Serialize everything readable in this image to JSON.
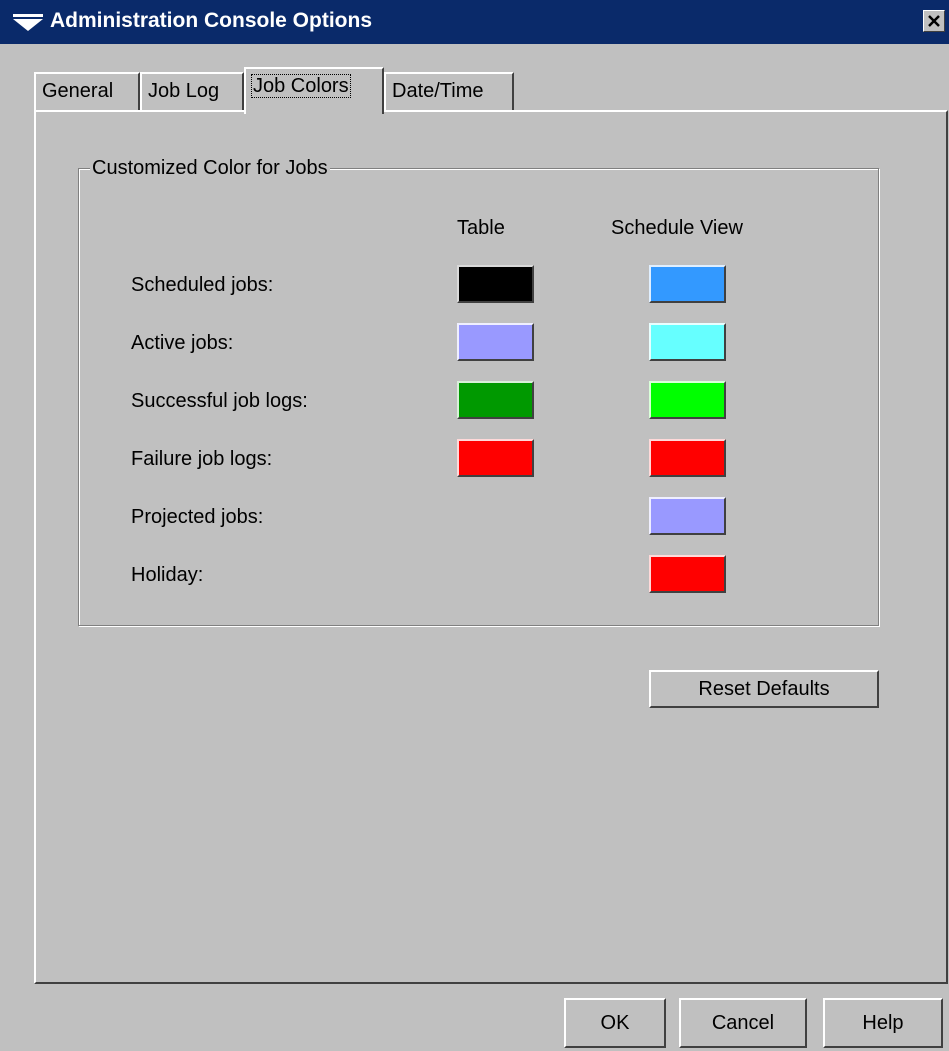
{
  "window": {
    "title": "Administration Console Options",
    "title_icon": "dropdown-triangle-icon",
    "close_icon": "close-icon"
  },
  "tabs": [
    {
      "label": "General",
      "active": false
    },
    {
      "label": "Job Log",
      "active": false
    },
    {
      "label": "Job Colors",
      "active": true
    },
    {
      "label": "Date/Time",
      "active": false
    }
  ],
  "group": {
    "title": "Customized Color for Jobs",
    "columns": {
      "table": "Table",
      "schedule": "Schedule View"
    },
    "rows": [
      {
        "label": "Scheduled jobs:",
        "table_color": "#000000",
        "schedule_color": "#3399ff"
      },
      {
        "label": "Active jobs:",
        "table_color": "#9999ff",
        "schedule_color": "#66ffff"
      },
      {
        "label": "Successful job logs:",
        "table_color": "#009900",
        "schedule_color": "#00ff00"
      },
      {
        "label": "Failure job logs:",
        "table_color": "#ff0000",
        "schedule_color": "#ff0000"
      },
      {
        "label": "Projected jobs:",
        "table_color": null,
        "schedule_color": "#9999ff"
      },
      {
        "label": "Holiday:",
        "table_color": null,
        "schedule_color": "#ff0000"
      }
    ]
  },
  "buttons": {
    "reset_defaults": "Reset Defaults",
    "ok": "OK",
    "cancel": "Cancel",
    "help": "Help"
  },
  "colors": {
    "titlebar": "#0a2a6a",
    "face": "#c0c0c0"
  }
}
